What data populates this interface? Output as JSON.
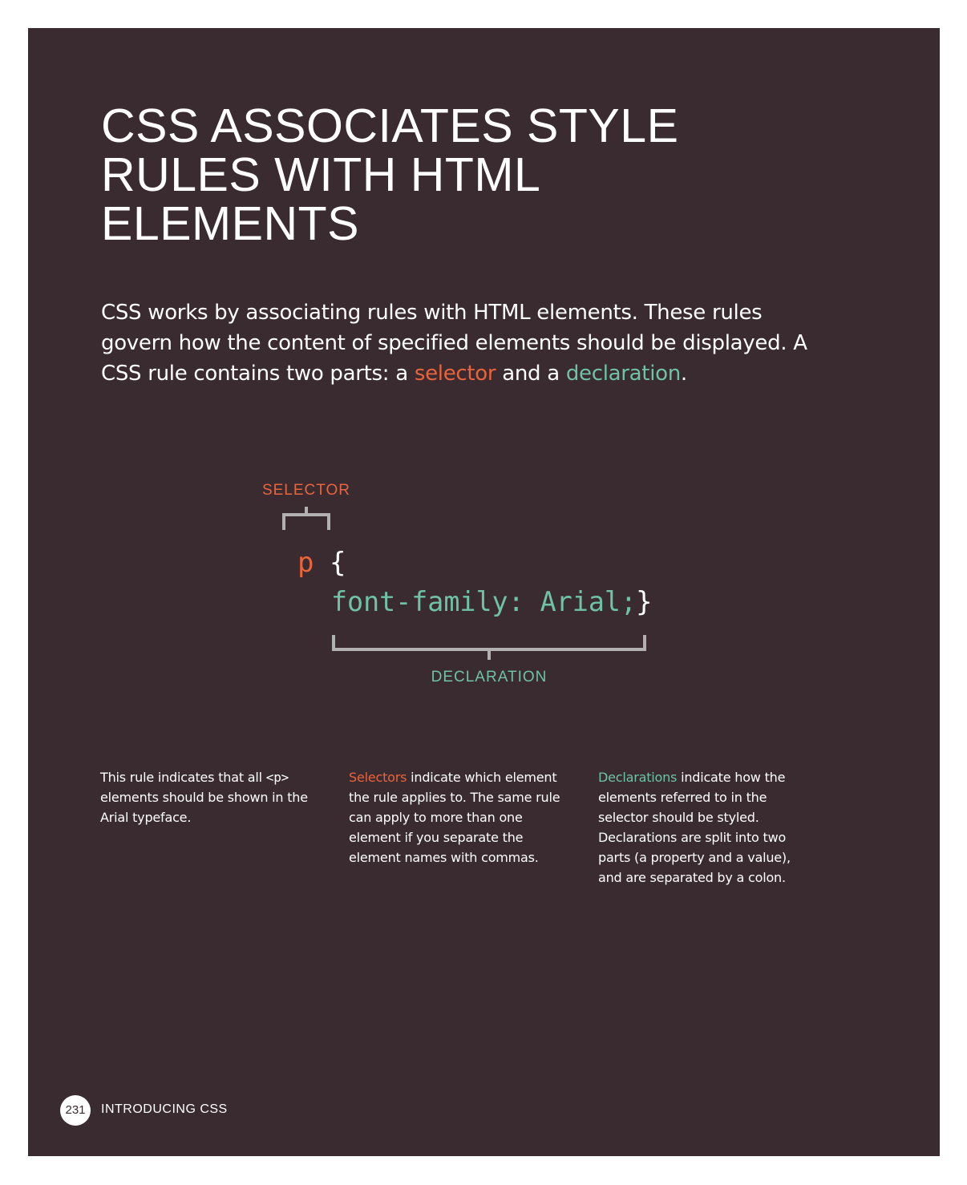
{
  "title": {
    "line1": "CSS ASSOCIATES STYLE",
    "line2": "RULES WITH HTML",
    "line3": "ELEMENTS"
  },
  "intro": {
    "text_a": "CSS works by associating rules with HTML elements. These rules govern how the content of specified elements should be displayed. A CSS rule contains two parts: a ",
    "selector_word": "selector",
    "text_b": " and a ",
    "declaration_word": "declaration",
    "text_c": "."
  },
  "diagram": {
    "selector_label": "SELECTOR",
    "declaration_label": "DECLARATION",
    "code_selector": "p",
    "code_open_brace": "{",
    "code_declaration": "font-family: Arial;",
    "code_close_brace": "}"
  },
  "columns": {
    "col1": {
      "text_a": "This rule indicates that all ",
      "tag": "<p>",
      "text_b": " elements should be shown in the Arial typeface."
    },
    "col2": {
      "highlight": "Selectors",
      "text": " indicate which element the rule applies to. The same rule can apply to more than one element if you separate the element names with commas."
    },
    "col3": {
      "highlight": "Declarations",
      "text": " indicate how the elements referred to in the selector should be styled. Declarations are split into two parts (a property and a value), and are separated by a colon."
    }
  },
  "footer": {
    "page_number": "231",
    "chapter": "INTRODUCING CSS"
  },
  "colors": {
    "background": "#3a2b31",
    "selector": "#e8643c",
    "declaration": "#6fc2a5",
    "bracket": "#b3b0b1"
  }
}
